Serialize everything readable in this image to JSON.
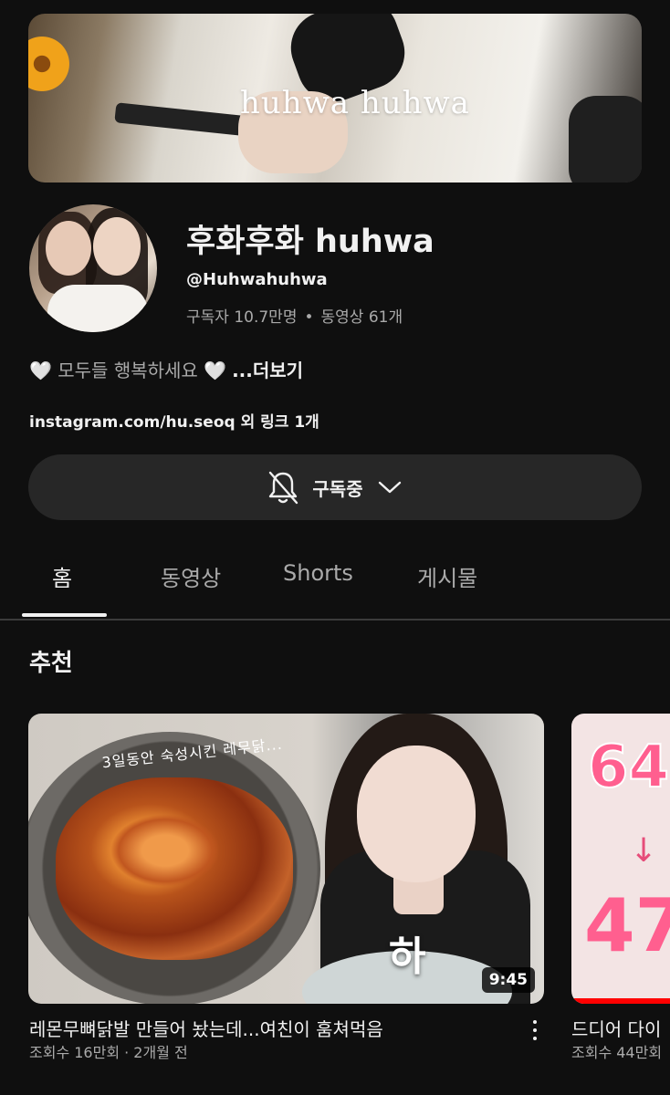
{
  "banner": {
    "title": "huhwa huhwa"
  },
  "channel": {
    "name": "후화후화 huhwa",
    "handle": "@Huhwahuhwa",
    "subscribers": "구독자 10.7만명",
    "dot": "•",
    "videos": "동영상 61개",
    "description": "🤍 모두들 행복하세요 🤍",
    "more": "...더보기",
    "links": "instagram.com/hu.seoq 외 링크 1개"
  },
  "subscribe_button": {
    "label": "구독중"
  },
  "tabs": [
    {
      "label": "홈",
      "active": true
    },
    {
      "label": "동영상",
      "active": false
    },
    {
      "label": "Shorts",
      "active": false
    },
    {
      "label": "게시물",
      "active": false
    }
  ],
  "section": {
    "title": "추천"
  },
  "videos": [
    {
      "title": "레몬무뼈닭발 만들어 놨는데...여친이 훔쳐먹음",
      "meta": "조회수 16만회 · 2개월 전",
      "duration": "9:45",
      "thumbnail_text": "3일동안 숙성시킨 레무닭...",
      "thumbnail_caption": "하"
    },
    {
      "title": "드디어 다이",
      "meta": "조회수 44만회",
      "thumbnail_top": "64",
      "thumbnail_arrow": "↓",
      "thumbnail_bottom": "47"
    }
  ],
  "colors": {
    "background": "#0f0f0f",
    "button_bg": "#272727",
    "text_secondary": "#aaaaaa"
  }
}
